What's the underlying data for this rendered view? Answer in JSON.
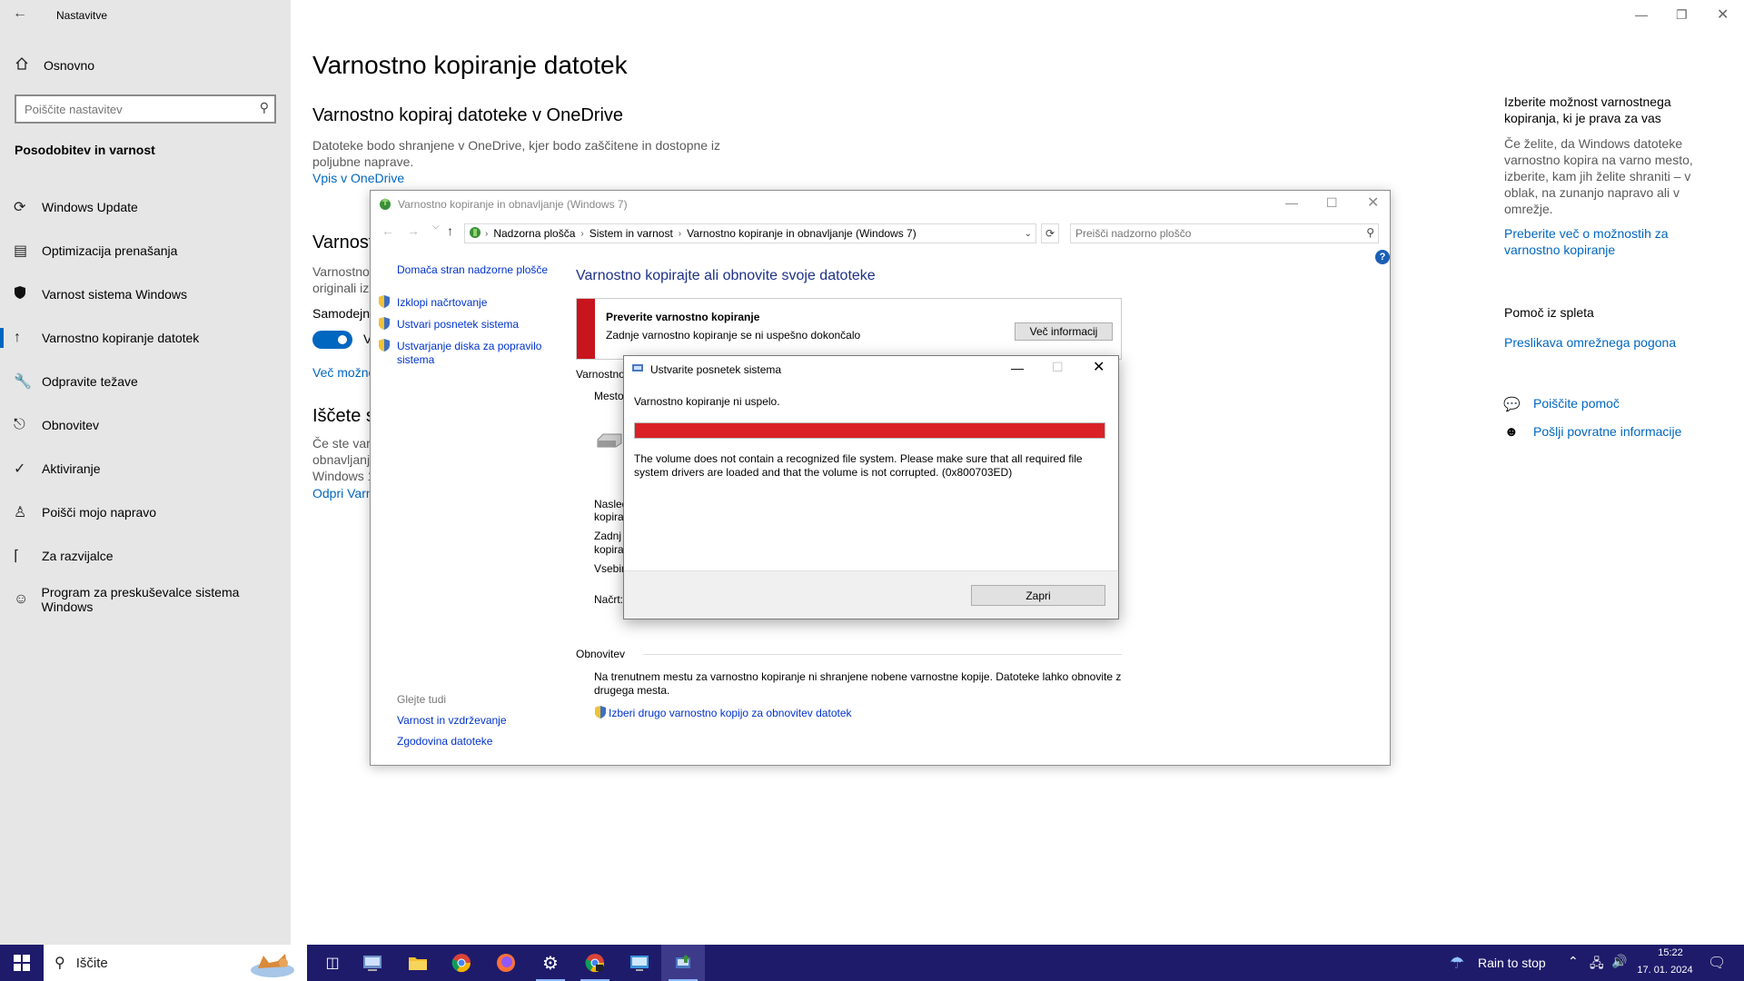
{
  "settings": {
    "window_title": "Nastavitve",
    "home_label": "Osnovno",
    "search_placeholder": "Poiščite nastavitev",
    "section_title": "Posodobitev in varnost",
    "nav": [
      {
        "label": "Windows Update",
        "icon": "sync-icon"
      },
      {
        "label": "Optimizacija prenašanja",
        "icon": "delivery-icon"
      },
      {
        "label": "Varnost sistema Windows",
        "icon": "shield-icon"
      },
      {
        "label": "Varnostno kopiranje datotek",
        "icon": "upload-arrow-icon"
      },
      {
        "label": "Odpravite težave",
        "icon": "wrench-icon"
      },
      {
        "label": "Obnovitev",
        "icon": "recovery-icon"
      },
      {
        "label": "Aktiviranje",
        "icon": "check-circle-icon"
      },
      {
        "label": "Poišči mojo napravo",
        "icon": "person-location-icon"
      },
      {
        "label": "Za razvijalce",
        "icon": "developer-icon"
      },
      {
        "label": "Program za preskuševalce sistema Windows",
        "icon": "insider-icon"
      }
    ],
    "active_nav_index": 3,
    "main": {
      "title": "Varnostno kopiranje datotek",
      "onedrive_heading": "Varnostno kopiraj datoteke v OneDrive",
      "onedrive_text_1": "Datoteke bodo shranjene v OneDrive, kjer bodo zaščitene in dostopne iz",
      "onedrive_text_2": "poljubne naprave.",
      "onedrive_link": "Vpis v OneDrive",
      "partial_heading": "Varnost",
      "partial_text_1": "Varnostno",
      "partial_text_2": "originali iz",
      "partial_auto": "Samodejn",
      "toggle_on": true,
      "toggle_label": "V",
      "partial_more": "Več možno",
      "partial_heading2": "Iščete s",
      "partial_text_3": "Če ste varn",
      "partial_text_4": "obnavljanj",
      "partial_text_5": "Windows 1",
      "partial_link2": "Odpri Varn"
    },
    "right_panel": {
      "title_1": "Izberite možnost varnostnega",
      "title_2": "kopiranja, ki je prava za vas",
      "text": [
        "Če želite, da Windows datoteke",
        "varnostno kopira na varno mesto,",
        "izberite, kam jih želite shraniti – v",
        "oblak, na zunanjo napravo ali v",
        "omrežje."
      ],
      "link_1a": "Preberite več o možnostih za",
      "link_1b": "varnostno kopiranje",
      "help_title": "Pomoč iz spleta",
      "help_link": "Preslikava omrežnega pogona",
      "get_help": "Poiščite pomoč",
      "feedback": "Pošlji povratne informacije"
    }
  },
  "control_panel": {
    "title": "Varnostno kopiranje in obnavljanje (Windows 7)",
    "breadcrumbs": [
      "Nadzorna plošča",
      "Sistem in varnost",
      "Varnostno kopiranje in obnavljanje (Windows 7)"
    ],
    "search_placeholder": "Preišči nadzorno ploščo",
    "left": {
      "home": "Domača stran nadzorne plošče",
      "links": [
        "Izklopi načrtovanje",
        "Ustvari posnetek sistema",
        "Ustvarjanje diska za popravilo",
        "sistema"
      ],
      "see_also": "Glejte tudi",
      "see_links": [
        "Varnost in vzdrževanje",
        "Zgodovina datoteke"
      ]
    },
    "main": {
      "heading": "Varnostno kopirajte ali obnovite svoje datoteke",
      "alert_title": "Preverite varnostno kopiranje",
      "alert_text": "Zadnje varnostno kopiranje se ni uspešno dokončalo",
      "alert_button": "Več informacij",
      "backup_label": "Varnostno",
      "location_label": "Mesto",
      "next_label_1": "Nasled",
      "next_label_2": "kopira",
      "last_label_1": "Zadnj",
      "last_label_2": "kopira",
      "contents_label": "Vsebin",
      "schedule_label": "Načrt:",
      "restore_section": "Obnovitev",
      "restore_text_1": "Na trenutnem mestu za varnostno kopiranje ni shranjene nobene varnostne kopije. Datoteke lahko obnovite z",
      "restore_text_2": "drugega mesta.",
      "restore_link": "Izberi drugo varnostno kopijo za obnovitev datotek"
    }
  },
  "dialog": {
    "title": "Ustvarite posnetek sistema",
    "status": "Varnostno kopiranje ni uspelo.",
    "progress_fraction": 1.0,
    "progress_color": "#d92127",
    "error_line_1": "The volume does not contain a recognized file system. Please make sure that all required file",
    "error_line_2": "system drivers are loaded and that the volume is not corrupted. (0x800703ED)",
    "close_button": "Zapri"
  },
  "taskbar": {
    "search_label": "Iščite",
    "weather": "Rain to stop",
    "time": "15:22",
    "date": "17. 01. 2024"
  },
  "colors": {
    "accent": "#0067c0",
    "taskbar": "#1f1b6b",
    "error_red": "#d92127",
    "cp_link": "#0033cc"
  }
}
